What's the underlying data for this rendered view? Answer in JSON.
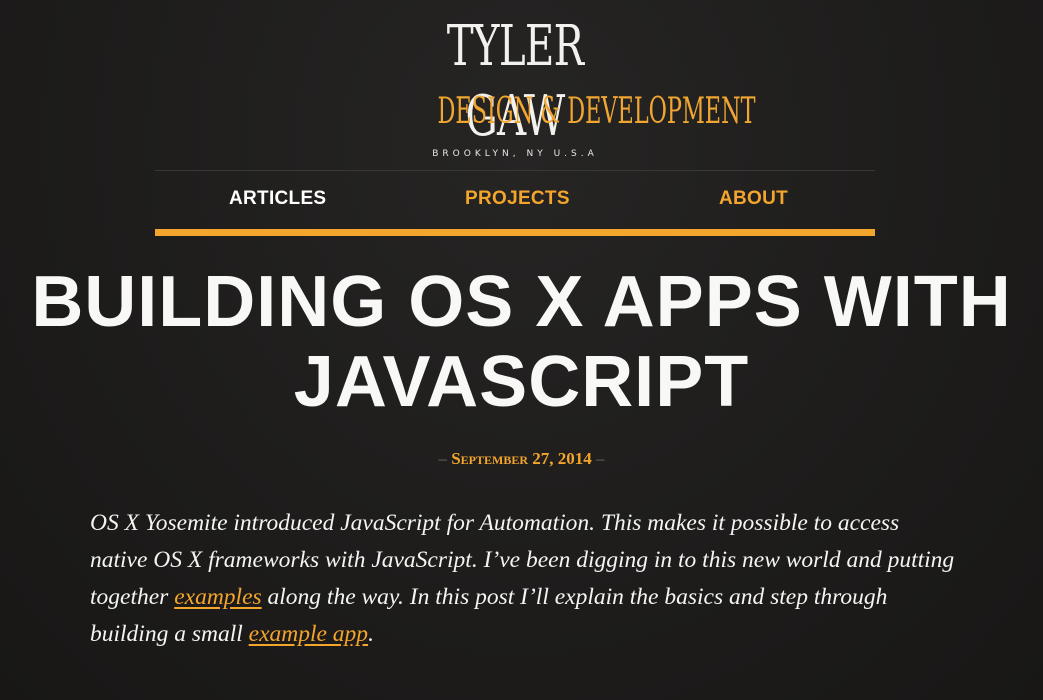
{
  "logo": {
    "name": "TYLER GAW",
    "tagline": "DESIGN & DEVELOPMENT",
    "location": "BROOKLYN, NY U.S.A"
  },
  "nav": {
    "items": [
      {
        "label": "ARTICLES",
        "active": true
      },
      {
        "label": "PROJECTS",
        "active": false
      },
      {
        "label": "ABOUT",
        "active": false
      }
    ]
  },
  "article": {
    "title": "BUILDING OS X APPS WITH JAVASCRIPT",
    "date": "September 27, 2014",
    "intro": {
      "part1": "OS X Yosemite introduced JavaScript for Automation. This makes it possible to access native OS X frameworks with JavaScript. I’ve been digging in to this new world and putting together ",
      "link1": "examples",
      "part2": " along the way. In this post I’ll explain the basics and step through building a small ",
      "link2": "example app",
      "part3": "."
    }
  },
  "colors": {
    "background": "#1e1d1c",
    "accent": "#f4a52c",
    "text": "#f4f4f2"
  }
}
